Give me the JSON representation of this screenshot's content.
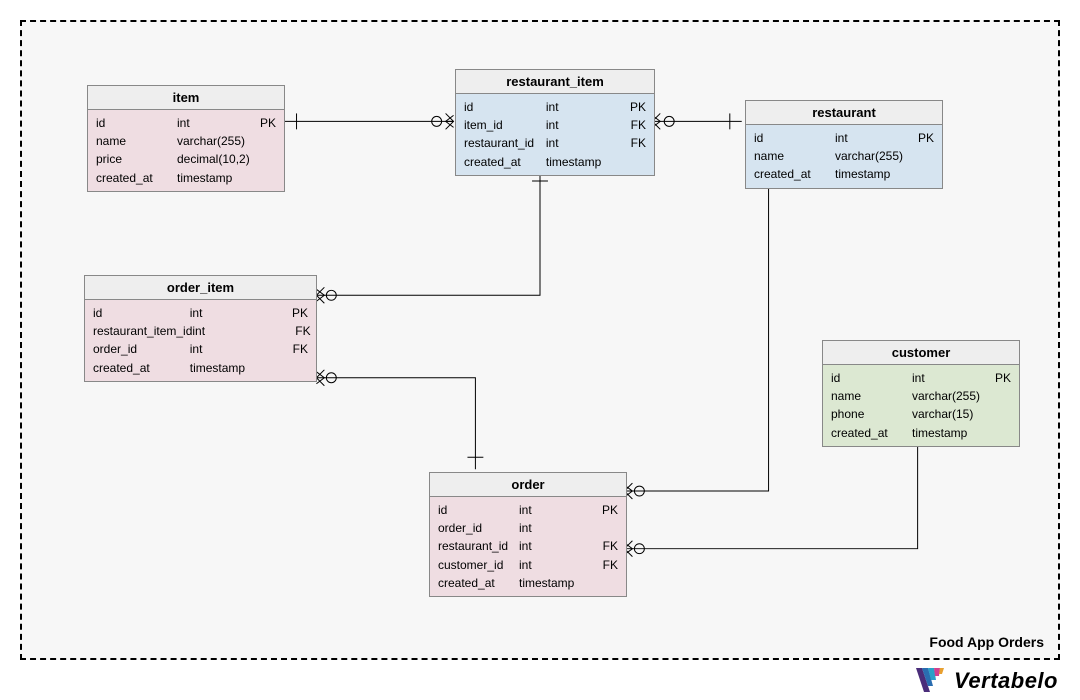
{
  "diagram": {
    "title": "Food App Orders",
    "logo_text": "Vertabelo"
  },
  "entities": {
    "item": {
      "name": "item",
      "columns": [
        {
          "name": "id",
          "type": "int",
          "key": "PK"
        },
        {
          "name": "name",
          "type": "varchar(255)",
          "key": ""
        },
        {
          "name": "price",
          "type": "decimal(10,2)",
          "key": ""
        },
        {
          "name": "created_at",
          "type": "timestamp",
          "key": ""
        }
      ]
    },
    "restaurant_item": {
      "name": "restaurant_item",
      "columns": [
        {
          "name": "id",
          "type": "int",
          "key": "PK"
        },
        {
          "name": "item_id",
          "type": "int",
          "key": "FK"
        },
        {
          "name": "restaurant_id",
          "type": "int",
          "key": "FK"
        },
        {
          "name": "created_at",
          "type": "timestamp",
          "key": ""
        }
      ]
    },
    "restaurant": {
      "name": "restaurant",
      "columns": [
        {
          "name": "id",
          "type": "int",
          "key": "PK"
        },
        {
          "name": "name",
          "type": "varchar(255)",
          "key": ""
        },
        {
          "name": "created_at",
          "type": "timestamp",
          "key": ""
        }
      ]
    },
    "order_item": {
      "name": "order_item",
      "columns": [
        {
          "name": "id",
          "type": "int",
          "key": "PK"
        },
        {
          "name": "restaurant_item_id",
          "type": "int",
          "key": "FK"
        },
        {
          "name": "order_id",
          "type": "int",
          "key": "FK"
        },
        {
          "name": "created_at",
          "type": "timestamp",
          "key": ""
        }
      ]
    },
    "order": {
      "name": "order",
      "columns": [
        {
          "name": "id",
          "type": "int",
          "key": "PK"
        },
        {
          "name": "order_id",
          "type": "int",
          "key": ""
        },
        {
          "name": "restaurant_id",
          "type": "int",
          "key": "FK"
        },
        {
          "name": "customer_id",
          "type": "int",
          "key": "FK"
        },
        {
          "name": "created_at",
          "type": "timestamp",
          "key": ""
        }
      ]
    },
    "customer": {
      "name": "customer",
      "columns": [
        {
          "name": "id",
          "type": "int",
          "key": "PK"
        },
        {
          "name": "name",
          "type": "varchar(255)",
          "key": ""
        },
        {
          "name": "phone",
          "type": "varchar(15)",
          "key": ""
        },
        {
          "name": "created_at",
          "type": "timestamp",
          "key": ""
        }
      ]
    }
  },
  "relationships": [
    {
      "from": "restaurant_item",
      "to": "item",
      "type": "many-to-one"
    },
    {
      "from": "restaurant_item",
      "to": "restaurant",
      "type": "many-to-one"
    },
    {
      "from": "order_item",
      "to": "restaurant_item",
      "type": "many-to-one"
    },
    {
      "from": "order_item",
      "to": "order",
      "type": "many-to-one"
    },
    {
      "from": "order",
      "to": "restaurant",
      "type": "many-to-one"
    },
    {
      "from": "order",
      "to": "customer",
      "type": "many-to-one"
    }
  ]
}
